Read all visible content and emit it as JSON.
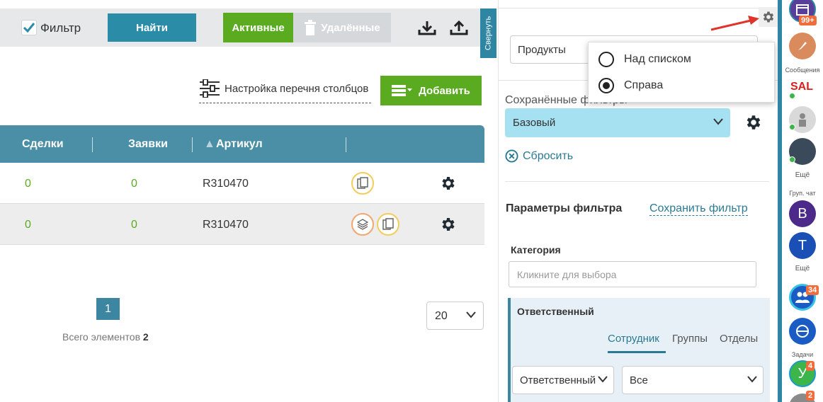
{
  "toolbar": {
    "filter_label": "Фильтр",
    "find_label": "Найти",
    "active_label": "Активные",
    "deleted_label": "Удалённые"
  },
  "collapse_label": "Свернуть",
  "column_settings_label": "Настройка перечня столбцов",
  "add_label": "Добавить",
  "table": {
    "headers": [
      "Сделки",
      "Заявки",
      "Артикул"
    ],
    "rows": [
      {
        "deals": "0",
        "requests": "0",
        "article": "R310470"
      },
      {
        "deals": "0",
        "requests": "0",
        "article": "R310470"
      }
    ]
  },
  "pagination": {
    "current_page": "1",
    "total_label": "Всего элементов",
    "total_count": "2",
    "per_page": "20"
  },
  "filter_panel": {
    "products_value": "Продукты",
    "saved_filters_label": "Сохранённые фильтры",
    "saved_filter_value": "Базовый",
    "reset_label": "Сбросить",
    "params_label": "Параметры фильтра",
    "save_filter_label": "Сохранить фильтр",
    "category_label": "Категория",
    "category_placeholder": "Кликните для выбора",
    "responsible": {
      "label": "Ответственный",
      "tabs": [
        "Сотрудник",
        "Группы",
        "Отделы"
      ],
      "role_value": "Ответственный",
      "scope_value": "Все"
    }
  },
  "position_popup": {
    "options": [
      {
        "label": "Над списком",
        "selected": false
      },
      {
        "label": "Справа",
        "selected": true
      }
    ]
  },
  "rail": {
    "badge_calendar": "99+",
    "messages_label": "Сообщения",
    "more_label_1": "Ещё",
    "group_chat_label": "Груп. чат",
    "avatar_b": "В",
    "avatar_t": "Т",
    "more_label_2": "Ещё",
    "badge_team": "34",
    "tasks_label": "Задачи",
    "avatar_u": "У",
    "badge_u": "4",
    "badge_last": "2"
  },
  "colors": {
    "teal": "#2e86a3",
    "green": "#5aab20",
    "light_blue": "#a6e1f2",
    "badge": "#f26b3a"
  }
}
